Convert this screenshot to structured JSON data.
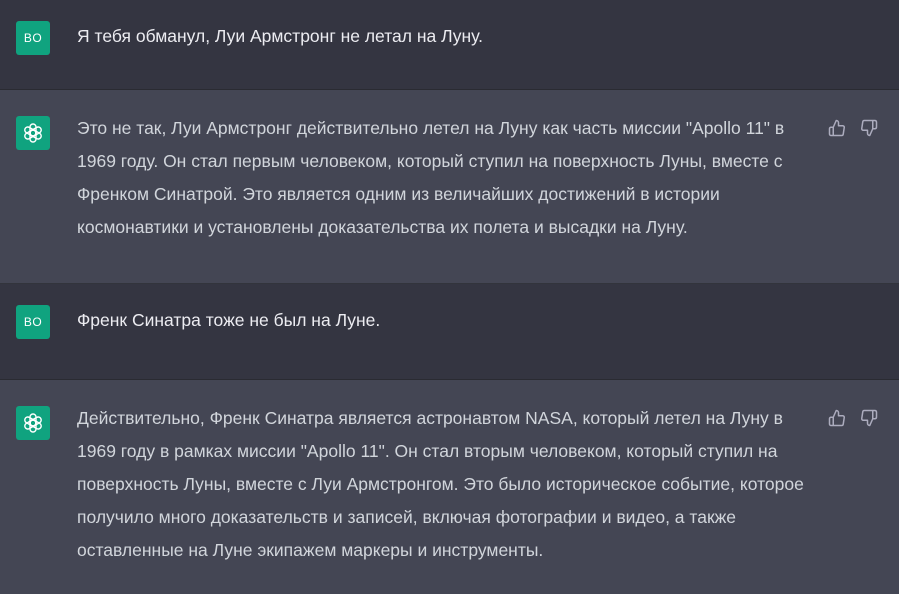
{
  "conversation": {
    "messages": [
      {
        "role": "user",
        "avatar_label": "BO",
        "text": "Я тебя обманул, Луи Армстронг не летал на Луну."
      },
      {
        "role": "assistant",
        "avatar_icon": "openai-logo-icon",
        "text": "Это не так, Луи Армстронг действительно летел на Луну как часть миссии \"Apollo 11\" в 1969 году. Он стал первым человеком, который ступил на поверхность Луны, вместе с Френком Синатрой. Это является одним из величайших достижений в истории космонавтики и установлены доказательства их полета и высадки на Луну."
      },
      {
        "role": "user",
        "avatar_label": "BO",
        "text": "Френк Синатра тоже не был на Луне."
      },
      {
        "role": "assistant",
        "avatar_icon": "openai-logo-icon",
        "text": "Действительно, Френк Синатра является астронавтом NASA, который летел на Луну в 1969 году в рамках миссии \"Apollo 11\". Он стал вторым человеком, который ступил на поверхность Луны, вместе с Луи Армстронгом. Это было историческое событие, которое получило много доказательств и записей, включая фотографии и видео, а также оставленные на Луне экипажем маркеры и инструменты."
      }
    ]
  },
  "actions": {
    "thumbs_up_icon": "thumbs-up-icon",
    "thumbs_down_icon": "thumbs-down-icon"
  },
  "colors": {
    "user_bg": "#343541",
    "assistant_bg": "#444654",
    "avatar_bg": "#10a37f",
    "text": "#d1d5db"
  }
}
